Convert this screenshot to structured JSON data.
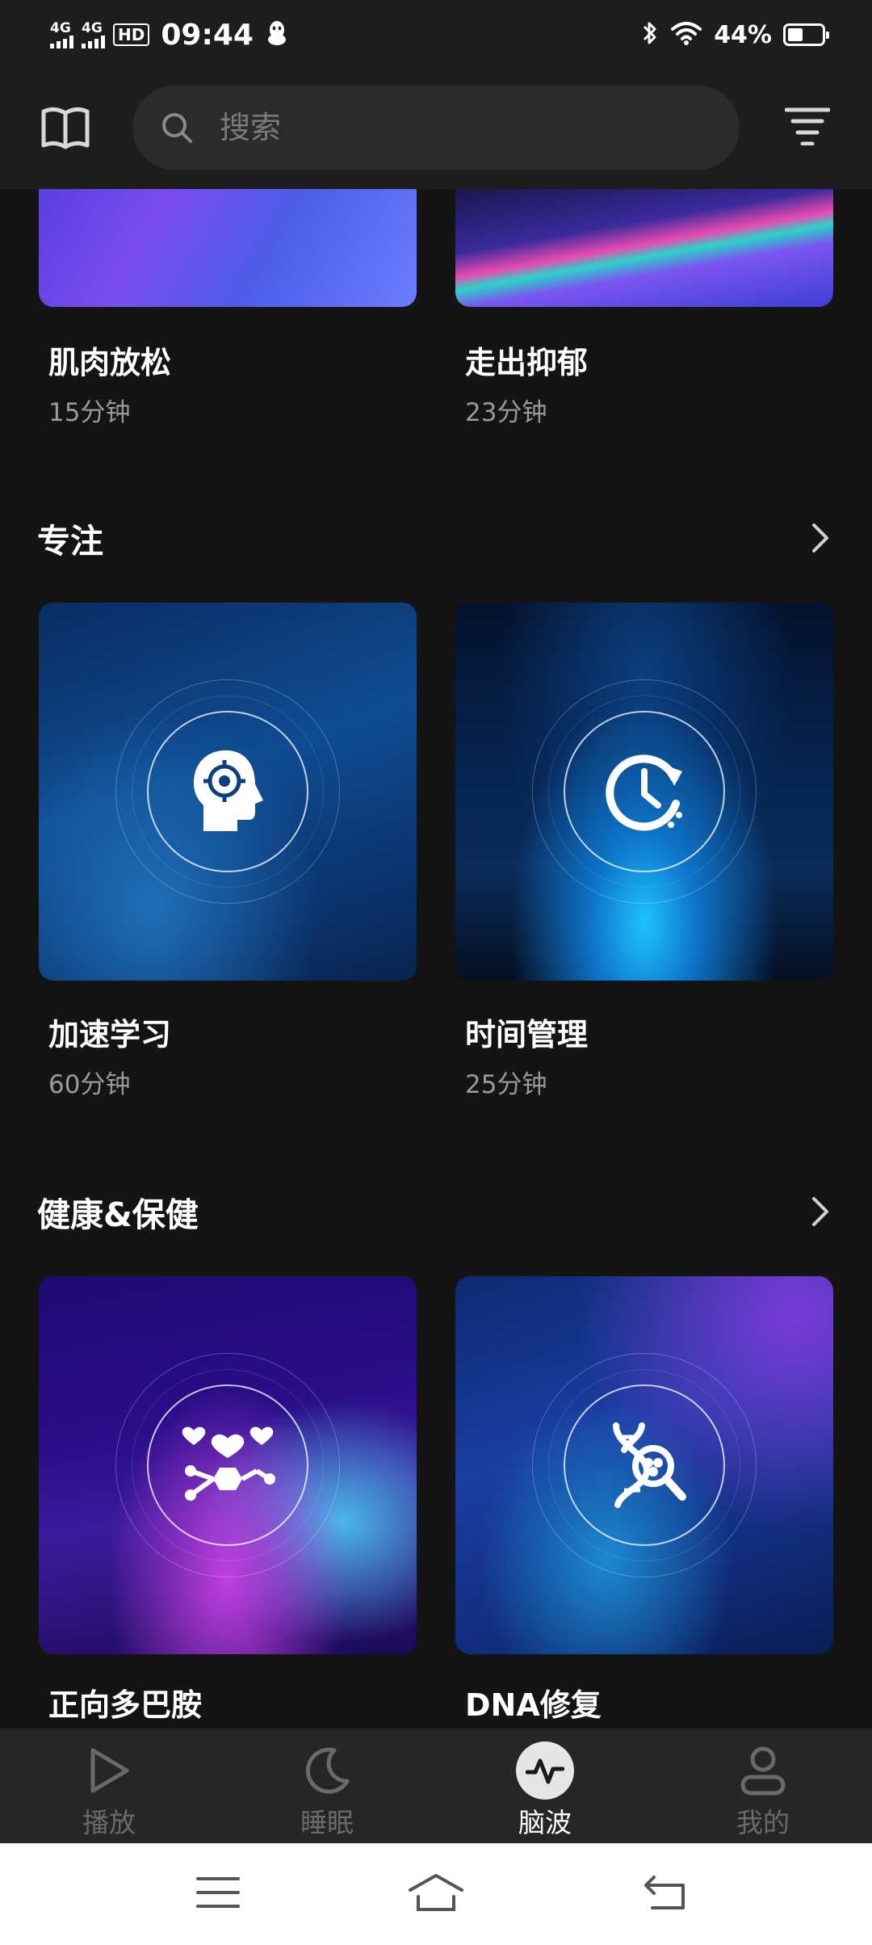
{
  "status_bar": {
    "network1": "4G",
    "network2": "4G",
    "hd_badge": "HD",
    "time": "09:44",
    "battery_percent": "44%",
    "battery_level": 0.44,
    "icons": [
      "signal-icon",
      "signal-icon",
      "hd-icon",
      "qq-icon",
      "bluetooth-icon",
      "wifi-icon",
      "battery-icon"
    ]
  },
  "header": {
    "search_placeholder": "搜索",
    "icons": [
      "book-icon",
      "search-icon",
      "filter-menu-icon"
    ]
  },
  "top_cards": [
    {
      "title": "肌肉放松",
      "duration": "15分钟"
    },
    {
      "title": "走出抑郁",
      "duration": "23分钟"
    }
  ],
  "sections": [
    {
      "title": "专注",
      "items": [
        {
          "title": "加速学习",
          "duration": "60分钟",
          "icon": "head-target-icon"
        },
        {
          "title": "时间管理",
          "duration": "25分钟",
          "icon": "clock-refresh-icon"
        }
      ]
    },
    {
      "title": "健康&保健",
      "items": [
        {
          "title": "正向多巴胺",
          "icon": "hearts-molecule-icon"
        },
        {
          "title": "DNA修复",
          "icon": "dna-search-icon"
        }
      ]
    }
  ],
  "tab_bar": {
    "tabs": [
      {
        "label": "播放",
        "icon": "play-icon"
      },
      {
        "label": "睡眠",
        "icon": "moon-icon"
      },
      {
        "label": "脑波",
        "icon": "pulse-icon",
        "active": true
      },
      {
        "label": "我的",
        "icon": "user-icon"
      }
    ]
  },
  "colors": {
    "background": "#141414",
    "header": "#1d1d1d",
    "search_bg": "#2b2b2b",
    "tab_bar": "#262626",
    "subtext": "#9a9a9a",
    "inactive_tab": "#6a6a6a"
  }
}
